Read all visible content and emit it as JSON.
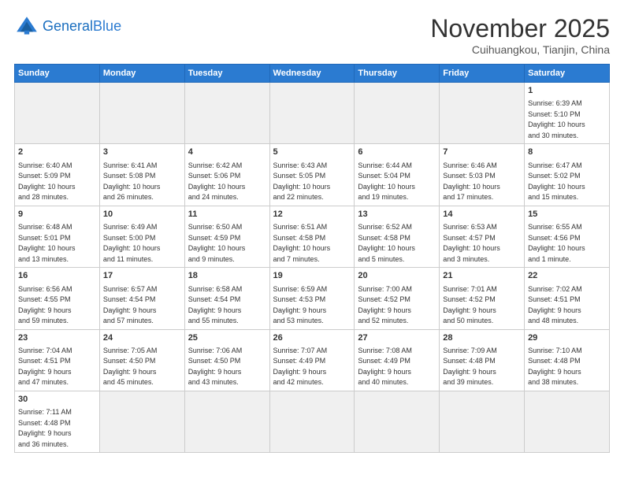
{
  "header": {
    "logo_general": "General",
    "logo_blue": "Blue",
    "month": "November 2025",
    "location": "Cuihuangkou, Tianjin, China"
  },
  "days_of_week": [
    "Sunday",
    "Monday",
    "Tuesday",
    "Wednesday",
    "Thursday",
    "Friday",
    "Saturday"
  ],
  "weeks": [
    [
      {
        "num": "",
        "info": "",
        "empty": true
      },
      {
        "num": "",
        "info": "",
        "empty": true
      },
      {
        "num": "",
        "info": "",
        "empty": true
      },
      {
        "num": "",
        "info": "",
        "empty": true
      },
      {
        "num": "",
        "info": "",
        "empty": true
      },
      {
        "num": "",
        "info": "",
        "empty": true
      },
      {
        "num": "1",
        "info": "Sunrise: 6:39 AM\nSunset: 5:10 PM\nDaylight: 10 hours\nand 30 minutes.",
        "empty": false
      }
    ],
    [
      {
        "num": "2",
        "info": "Sunrise: 6:40 AM\nSunset: 5:09 PM\nDaylight: 10 hours\nand 28 minutes.",
        "empty": false
      },
      {
        "num": "3",
        "info": "Sunrise: 6:41 AM\nSunset: 5:08 PM\nDaylight: 10 hours\nand 26 minutes.",
        "empty": false
      },
      {
        "num": "4",
        "info": "Sunrise: 6:42 AM\nSunset: 5:06 PM\nDaylight: 10 hours\nand 24 minutes.",
        "empty": false
      },
      {
        "num": "5",
        "info": "Sunrise: 6:43 AM\nSunset: 5:05 PM\nDaylight: 10 hours\nand 22 minutes.",
        "empty": false
      },
      {
        "num": "6",
        "info": "Sunrise: 6:44 AM\nSunset: 5:04 PM\nDaylight: 10 hours\nand 19 minutes.",
        "empty": false
      },
      {
        "num": "7",
        "info": "Sunrise: 6:46 AM\nSunset: 5:03 PM\nDaylight: 10 hours\nand 17 minutes.",
        "empty": false
      },
      {
        "num": "8",
        "info": "Sunrise: 6:47 AM\nSunset: 5:02 PM\nDaylight: 10 hours\nand 15 minutes.",
        "empty": false
      }
    ],
    [
      {
        "num": "9",
        "info": "Sunrise: 6:48 AM\nSunset: 5:01 PM\nDaylight: 10 hours\nand 13 minutes.",
        "empty": false
      },
      {
        "num": "10",
        "info": "Sunrise: 6:49 AM\nSunset: 5:00 PM\nDaylight: 10 hours\nand 11 minutes.",
        "empty": false
      },
      {
        "num": "11",
        "info": "Sunrise: 6:50 AM\nSunset: 4:59 PM\nDaylight: 10 hours\nand 9 minutes.",
        "empty": false
      },
      {
        "num": "12",
        "info": "Sunrise: 6:51 AM\nSunset: 4:58 PM\nDaylight: 10 hours\nand 7 minutes.",
        "empty": false
      },
      {
        "num": "13",
        "info": "Sunrise: 6:52 AM\nSunset: 4:58 PM\nDaylight: 10 hours\nand 5 minutes.",
        "empty": false
      },
      {
        "num": "14",
        "info": "Sunrise: 6:53 AM\nSunset: 4:57 PM\nDaylight: 10 hours\nand 3 minutes.",
        "empty": false
      },
      {
        "num": "15",
        "info": "Sunrise: 6:55 AM\nSunset: 4:56 PM\nDaylight: 10 hours\nand 1 minute.",
        "empty": false
      }
    ],
    [
      {
        "num": "16",
        "info": "Sunrise: 6:56 AM\nSunset: 4:55 PM\nDaylight: 9 hours\nand 59 minutes.",
        "empty": false
      },
      {
        "num": "17",
        "info": "Sunrise: 6:57 AM\nSunset: 4:54 PM\nDaylight: 9 hours\nand 57 minutes.",
        "empty": false
      },
      {
        "num": "18",
        "info": "Sunrise: 6:58 AM\nSunset: 4:54 PM\nDaylight: 9 hours\nand 55 minutes.",
        "empty": false
      },
      {
        "num": "19",
        "info": "Sunrise: 6:59 AM\nSunset: 4:53 PM\nDaylight: 9 hours\nand 53 minutes.",
        "empty": false
      },
      {
        "num": "20",
        "info": "Sunrise: 7:00 AM\nSunset: 4:52 PM\nDaylight: 9 hours\nand 52 minutes.",
        "empty": false
      },
      {
        "num": "21",
        "info": "Sunrise: 7:01 AM\nSunset: 4:52 PM\nDaylight: 9 hours\nand 50 minutes.",
        "empty": false
      },
      {
        "num": "22",
        "info": "Sunrise: 7:02 AM\nSunset: 4:51 PM\nDaylight: 9 hours\nand 48 minutes.",
        "empty": false
      }
    ],
    [
      {
        "num": "23",
        "info": "Sunrise: 7:04 AM\nSunset: 4:51 PM\nDaylight: 9 hours\nand 47 minutes.",
        "empty": false
      },
      {
        "num": "24",
        "info": "Sunrise: 7:05 AM\nSunset: 4:50 PM\nDaylight: 9 hours\nand 45 minutes.",
        "empty": false
      },
      {
        "num": "25",
        "info": "Sunrise: 7:06 AM\nSunset: 4:50 PM\nDaylight: 9 hours\nand 43 minutes.",
        "empty": false
      },
      {
        "num": "26",
        "info": "Sunrise: 7:07 AM\nSunset: 4:49 PM\nDaylight: 9 hours\nand 42 minutes.",
        "empty": false
      },
      {
        "num": "27",
        "info": "Sunrise: 7:08 AM\nSunset: 4:49 PM\nDaylight: 9 hours\nand 40 minutes.",
        "empty": false
      },
      {
        "num": "28",
        "info": "Sunrise: 7:09 AM\nSunset: 4:48 PM\nDaylight: 9 hours\nand 39 minutes.",
        "empty": false
      },
      {
        "num": "29",
        "info": "Sunrise: 7:10 AM\nSunset: 4:48 PM\nDaylight: 9 hours\nand 38 minutes.",
        "empty": false
      }
    ],
    [
      {
        "num": "30",
        "info": "Sunrise: 7:11 AM\nSunset: 4:48 PM\nDaylight: 9 hours\nand 36 minutes.",
        "empty": false
      },
      {
        "num": "",
        "info": "",
        "empty": true
      },
      {
        "num": "",
        "info": "",
        "empty": true
      },
      {
        "num": "",
        "info": "",
        "empty": true
      },
      {
        "num": "",
        "info": "",
        "empty": true
      },
      {
        "num": "",
        "info": "",
        "empty": true
      },
      {
        "num": "",
        "info": "",
        "empty": true
      }
    ]
  ]
}
